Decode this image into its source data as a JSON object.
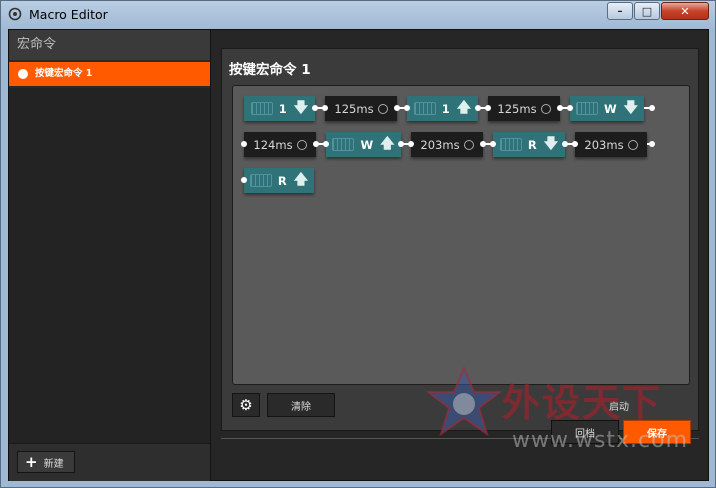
{
  "window": {
    "title": "Macro Editor",
    "min_symbol": "–",
    "max_symbol": "□",
    "close_symbol": "✕"
  },
  "sidebar": {
    "header": "宏命令",
    "items": [
      {
        "label": "按键宏命令 1",
        "selected": true
      }
    ],
    "new_button": "新建"
  },
  "editor": {
    "title": "按键宏命令 1",
    "sequence": [
      {
        "type": "key",
        "key": "1",
        "direction": "down"
      },
      {
        "type": "delay",
        "value": "125",
        "unit": "ms"
      },
      {
        "type": "key",
        "key": "1",
        "direction": "up"
      },
      {
        "type": "delay",
        "value": "125",
        "unit": "ms"
      },
      {
        "type": "key",
        "key": "W",
        "direction": "down"
      },
      {
        "type": "delay",
        "value": "124",
        "unit": "ms"
      },
      {
        "type": "key",
        "key": "W",
        "direction": "up"
      },
      {
        "type": "delay",
        "value": "203",
        "unit": "ms"
      },
      {
        "type": "key",
        "key": "R",
        "direction": "down"
      },
      {
        "type": "delay",
        "value": "203",
        "unit": "ms"
      },
      {
        "type": "key",
        "key": "R",
        "direction": "up"
      }
    ],
    "clear_button": "清除",
    "start_button": "启动"
  },
  "footer": {
    "revert_button": "回档",
    "save_button": "保存"
  },
  "watermark": {
    "title": "外设天下",
    "url": "www.wstx.com"
  },
  "colors": {
    "accent": "#ff5a00",
    "key_node": "#2f7379",
    "delay_node": "#1d1d1d"
  }
}
